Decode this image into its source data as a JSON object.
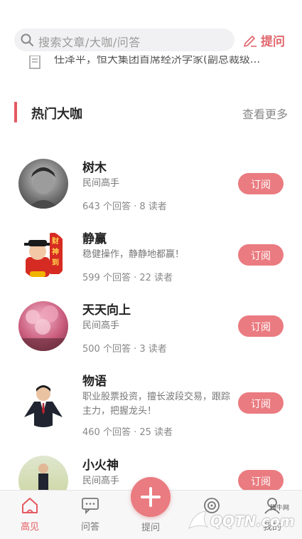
{
  "header": {
    "search_placeholder": "搜索文章/大咖/问答",
    "ask_label": "提问"
  },
  "news_ticker": "任泽平，恒大集团首席经济学家(副总裁级...",
  "section": {
    "title": "热门大咖",
    "more": "查看更多"
  },
  "experts": [
    {
      "name": "树木",
      "desc": "民间高手",
      "stats": "643 个回答 · 8 读者",
      "action": "订阅"
    },
    {
      "name": "静赢",
      "desc": "稳健操作，静静地都赢！",
      "stats": "599 个回答 · 22 读者",
      "action": "订阅"
    },
    {
      "name": "天天向上",
      "desc": "民间高手",
      "stats": "500 个回答 · 3 读者",
      "action": "订阅"
    },
    {
      "name": "物语",
      "desc": "职业股票投资，擅长波段交易，跟踪主力，把握龙头！",
      "stats": "460 个回答 · 25 读者",
      "action": "订阅"
    },
    {
      "name": "小火神",
      "desc": "民间高手",
      "stats": "",
      "action": "订阅"
    }
  ],
  "avatar_badge": "财神到",
  "tabs": [
    {
      "label": "高见",
      "icon": "home-icon",
      "active": true
    },
    {
      "label": "问答",
      "icon": "chat-icon",
      "active": false
    },
    {
      "label": "提问",
      "icon": "plus-icon",
      "active": false
    },
    {
      "label": "",
      "icon": "target-icon",
      "active": false
    },
    {
      "label": "我的",
      "icon": "user-icon",
      "active": false
    }
  ],
  "watermark": {
    "text": "QQTN.com",
    "sub": "腾牛网"
  },
  "colors": {
    "accent": "#e45a61",
    "button": "#ea7b80"
  }
}
